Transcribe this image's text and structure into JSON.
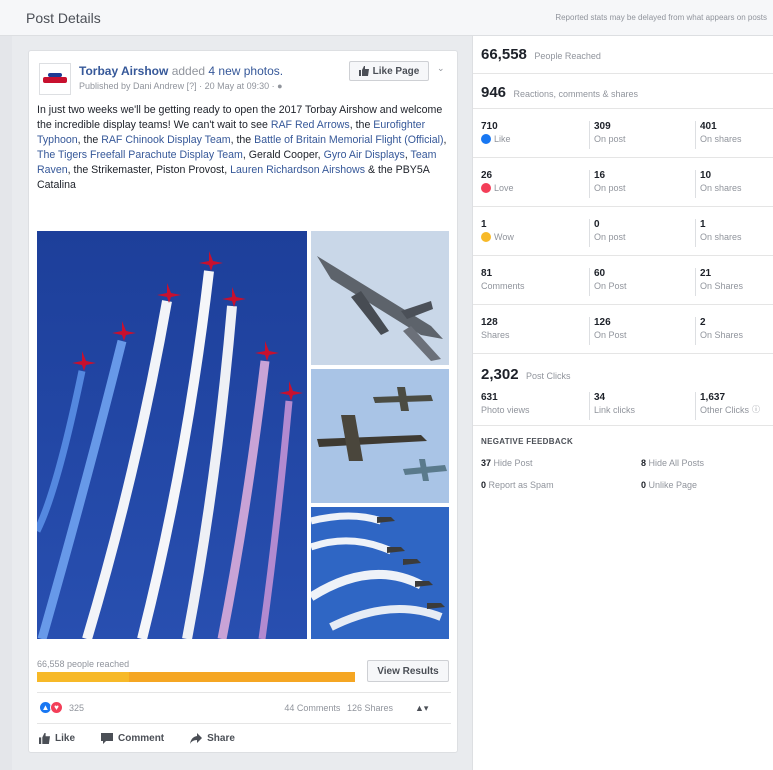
{
  "header": {
    "title": "Post Details",
    "note": "Reported stats may be delayed from what appears on posts"
  },
  "post": {
    "page_name": "Torbay Airshow",
    "added_text": "added",
    "photos_text": "4 new photos.",
    "published": "Published by Dani Andrew [?] · 20 May at 09:30 ·",
    "like_page_label": "Like Page",
    "text": {
      "t1": "In just two weeks we'll be getting ready to open the 2017 Torbay Airshow and welcome the incredible display teams! We can't wait to see ",
      "l1": "RAF Red Arrows",
      "t2": ", the ",
      "l2": "Eurofighter Typhoon",
      "t3": ", the ",
      "l3": "RAF Chinook Display Team",
      "t4": ", the ",
      "l4": "Battle of Britain Memorial Flight (Official)",
      "t5": ", ",
      "l5": "The Tigers Freefall Parachute Display Team",
      "t6": ", Gerald Cooper, ",
      "l6": "Gyro Air Displays",
      "t7": ", ",
      "l7": "Team Raven",
      "t8": ", the Strikemaster, Piston Provost, ",
      "l8": "Lauren Richardson Airshows",
      "t9": " & the PBY5A Catalina"
    },
    "reached_text": "66,558 people reached",
    "reach_bar": {
      "organic_fraction": 0.29,
      "paid_fraction": 0.71
    },
    "view_results_label": "View Results",
    "reaction_count": "325",
    "comments_text": "44 Comments",
    "shares_text": "126 Shares",
    "actions": {
      "like": "Like",
      "comment": "Comment",
      "share": "Share"
    }
  },
  "stats": {
    "people_reached": {
      "value": "66,558",
      "label": "People Reached"
    },
    "reactions_total": {
      "value": "946",
      "label": "Reactions, comments & shares"
    },
    "rows": [
      {
        "cells": [
          {
            "num": "710",
            "label": "Like",
            "icon": "like"
          },
          {
            "num": "309",
            "label": "On post"
          },
          {
            "num": "401",
            "label": "On shares"
          }
        ]
      },
      {
        "cells": [
          {
            "num": "26",
            "label": "Love",
            "icon": "love"
          },
          {
            "num": "16",
            "label": "On post"
          },
          {
            "num": "10",
            "label": "On shares"
          }
        ]
      },
      {
        "cells": [
          {
            "num": "1",
            "label": "Wow",
            "icon": "wow"
          },
          {
            "num": "0",
            "label": "On post"
          },
          {
            "num": "1",
            "label": "On shares"
          }
        ]
      },
      {
        "cells": [
          {
            "num": "81",
            "label": "Comments"
          },
          {
            "num": "60",
            "label": "On Post"
          },
          {
            "num": "21",
            "label": "On Shares"
          }
        ]
      },
      {
        "cells": [
          {
            "num": "128",
            "label": "Shares"
          },
          {
            "num": "126",
            "label": "On Post"
          },
          {
            "num": "2",
            "label": "On Shares"
          }
        ]
      }
    ],
    "post_clicks": {
      "value": "2,302",
      "label": "Post Clicks"
    },
    "clicks": [
      {
        "num": "631",
        "label": "Photo views"
      },
      {
        "num": "34",
        "label": "Link clicks"
      },
      {
        "num": "1,637",
        "label": "Other Clicks"
      }
    ],
    "negative": {
      "title": "NEGATIVE FEEDBACK",
      "items": [
        {
          "num": "37",
          "label": "Hide Post"
        },
        {
          "num": "8",
          "label": "Hide All Posts"
        },
        {
          "num": "0",
          "label": "Report as Spam"
        },
        {
          "num": "0",
          "label": "Unlike Page"
        }
      ]
    }
  },
  "colors": {
    "link": "#365899",
    "like": "#1877f2",
    "love": "#f33e58",
    "bar": "#f5a623"
  }
}
